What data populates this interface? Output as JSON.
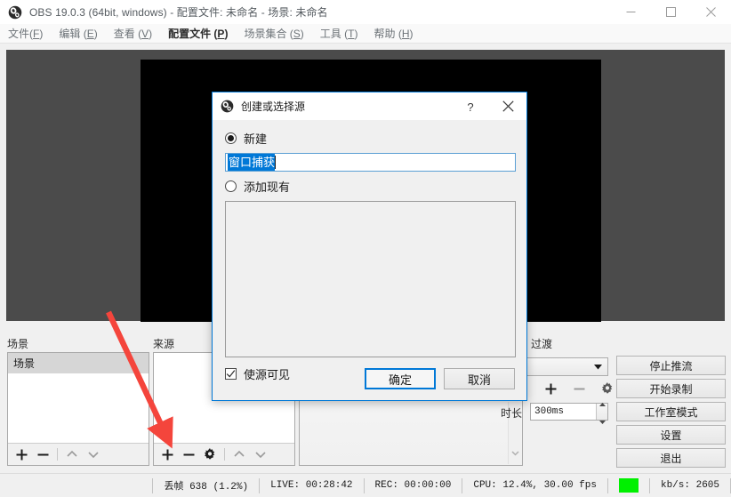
{
  "titlebar": {
    "title": "OBS 19.0.3 (64bit, windows) - 配置文件: 未命名 - 场景: 未命名",
    "logo_icon": "obs-logo-icon",
    "minimize_icon": "minimize-icon",
    "maximize_icon": "maximize-icon",
    "close_icon": "close-icon"
  },
  "menubar": {
    "items": [
      {
        "label": "文件",
        "mnemonic": "F"
      },
      {
        "label": "编辑 ",
        "mnemonic": "E"
      },
      {
        "label": "查看 ",
        "mnemonic": "V"
      },
      {
        "label": "配置文件 ",
        "mnemonic": "P",
        "active": true
      },
      {
        "label": "场景集合 ",
        "mnemonic": "S"
      },
      {
        "label": "工具 ",
        "mnemonic": "T"
      },
      {
        "label": "帮助 ",
        "mnemonic": "H"
      }
    ]
  },
  "docks": {
    "scenes_label": "场景",
    "sources_label": "来源",
    "mixer_label": "",
    "transitions_label": "过渡"
  },
  "scenes": {
    "items": [
      {
        "name": "场景",
        "selected": true
      }
    ],
    "toolbar": {
      "add_icon": "plus-icon",
      "remove_icon": "minus-icon",
      "up_icon": "chevron-up-icon",
      "down_icon": "chevron-down-icon"
    }
  },
  "sources": {
    "items": [],
    "toolbar": {
      "add_icon": "plus-icon",
      "remove_icon": "minus-icon",
      "properties_icon": "gear-icon",
      "up_icon": "chevron-up-icon",
      "down_icon": "chevron-down-icon"
    }
  },
  "mixer": {
    "items": [],
    "scroll_icon": "chevron-down-icon"
  },
  "transitions": {
    "selected": "",
    "dropdown_icon": "chevron-down-icon",
    "add_icon": "plus-icon",
    "remove_icon": "minus-icon",
    "config_icon": "gear-icon",
    "duration_label": "时长",
    "duration_value": "300ms",
    "spin_up_icon": "spinner-up-icon",
    "spin_down_icon": "spinner-down-icon"
  },
  "controls": {
    "buttons": [
      {
        "label": "停止推流"
      },
      {
        "label": "开始录制"
      },
      {
        "label": "工作室模式"
      },
      {
        "label": "设置"
      },
      {
        "label": "退出"
      }
    ]
  },
  "statusbar": {
    "dropped_frames": "丢帧 638 (1.2%)",
    "live": "LIVE: 00:28:42",
    "rec": "REC: 00:00:00",
    "cpu": "CPU: 12.4%, 30.00 fps",
    "led_color": "#00f000",
    "bitrate": "kb/s: 2605"
  },
  "dialog": {
    "logo_icon": "obs-logo-icon",
    "title": "创建或选择源",
    "help_icon": "question-mark-icon",
    "close_icon": "close-icon",
    "radio_new_label": "新建",
    "radio_new_selected": true,
    "name_value": "窗口捕获",
    "name_placeholder": "",
    "radio_existing_label": "添加现有",
    "radio_existing_selected": false,
    "existing_items": [],
    "visible_checkbox_label": "使源可见",
    "visible_checkbox_checked": true,
    "ok_label": "确定",
    "cancel_label": "取消"
  },
  "annotation": {
    "arrow_color": "#f4453c"
  }
}
